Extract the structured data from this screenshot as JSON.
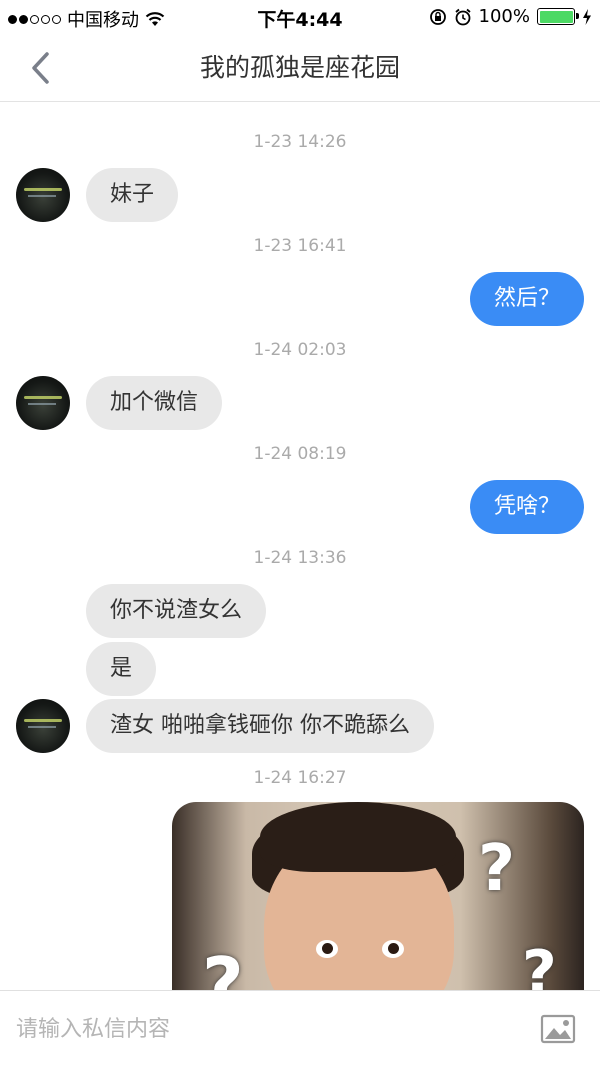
{
  "status_bar": {
    "carrier": "中国移动",
    "time": "下午4:44",
    "battery": "100%",
    "battery_level": 1.0,
    "icons": [
      "signal-icon",
      "wifi-icon",
      "rotation-lock-icon",
      "alarm-icon",
      "battery-icon",
      "charging-icon"
    ]
  },
  "nav": {
    "title": "我的孤独是座花园",
    "back_icon": "chevron-left-icon"
  },
  "messages": [
    {
      "timestamp": "1-23 14:26"
    },
    {
      "direction": "incoming",
      "text": "妹子"
    },
    {
      "timestamp": "1-23 16:41"
    },
    {
      "direction": "outgoing",
      "text": "然后？"
    },
    {
      "timestamp": "1-24 02:03"
    },
    {
      "direction": "incoming",
      "text": "加个微信"
    },
    {
      "timestamp": "1-24 08:19"
    },
    {
      "direction": "outgoing",
      "text": "凭啥？"
    },
    {
      "timestamp": "1-24 13:36"
    },
    {
      "direction": "incoming",
      "text": "你不说渣女么"
    },
    {
      "direction": "incoming",
      "text": "是"
    },
    {
      "direction": "incoming",
      "text": "渣女 啪啪拿钱砸你 你不跪舔么"
    },
    {
      "timestamp": "1-24 16:27"
    },
    {
      "direction": "outgoing",
      "type": "image",
      "question_mark": "?"
    }
  ],
  "input_bar": {
    "placeholder": "请输入私信内容",
    "image_icon": "image-icon"
  },
  "colors": {
    "outgoing_bubble": "#3a8cf5",
    "incoming_bubble": "#e8e8e8",
    "timestamp": "#aaaaaa",
    "placeholder": "#b5b5b5"
  }
}
